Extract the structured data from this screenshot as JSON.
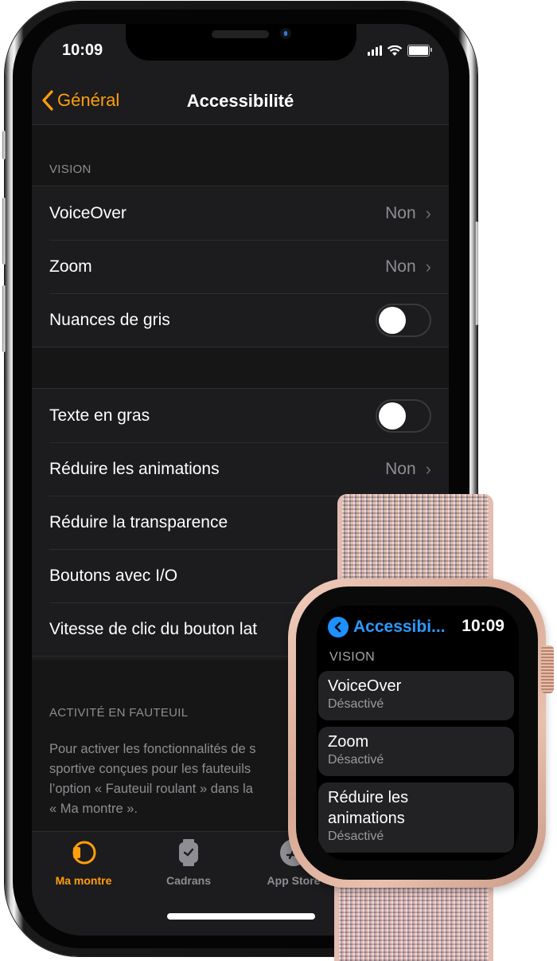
{
  "status_bar": {
    "time": "10:09"
  },
  "navbar": {
    "back_label": "Général",
    "title": "Accessibilité"
  },
  "vision_section": {
    "header": "VISION",
    "rows": [
      {
        "label": "VoiceOver",
        "value": "Non",
        "type": "disclosure"
      },
      {
        "label": "Zoom",
        "value": "Non",
        "type": "disclosure"
      },
      {
        "label": "Nuances de gris",
        "type": "toggle",
        "on": false
      }
    ]
  },
  "display_section": {
    "rows": [
      {
        "label": "Texte en gras",
        "type": "toggle",
        "on": false
      },
      {
        "label": "Réduire les animations",
        "value": "Non",
        "type": "disclosure"
      },
      {
        "label": "Réduire la transparence",
        "type": "toggle"
      },
      {
        "label": "Boutons avec I/O",
        "type": "toggle"
      },
      {
        "label": "Vitesse de clic du bouton lat",
        "type": "disclosure"
      }
    ]
  },
  "wheelchair_section": {
    "header": "ACTIVITÉ EN FAUTEUIL",
    "footer_lines": [
      "Pour activer les fonctionnalités de s",
      "sportive conçues pour les fauteuils",
      "l’option « Fauteuil roulant » dans la",
      "« Ma montre »."
    ]
  },
  "tabbar": {
    "active_color": "#ff9f0a",
    "inactive_color": "#8d8d93",
    "tabs": [
      {
        "label": "Ma montre",
        "icon": "watch-band-icon",
        "active": true
      },
      {
        "label": "Cadrans",
        "icon": "watch-face-icon",
        "active": false
      },
      {
        "label": "App Store",
        "icon": "app-store-icon",
        "active": false
      }
    ]
  },
  "watch": {
    "back_title": "Accessibi...",
    "time": "10:09",
    "section": "VISION",
    "items": [
      {
        "title": "VoiceOver",
        "subtitle": "Désactivé"
      },
      {
        "title": "Zoom",
        "subtitle": "Désactivé"
      },
      {
        "title": "Réduire les animations",
        "subtitle": "Désactivé"
      }
    ],
    "accent_color": "#2a9bff"
  },
  "colors": {
    "accent_orange": "#ff9f0a",
    "background": "#1c1c1e",
    "secondary_text": "#8d8d93"
  }
}
